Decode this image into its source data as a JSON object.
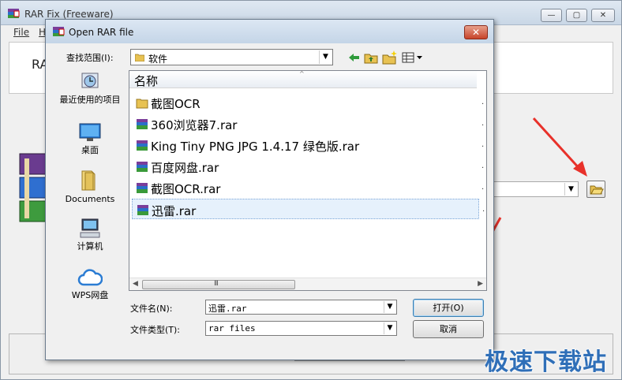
{
  "app": {
    "title": "RAR Fix (Freeware)",
    "menu": {
      "file": "File",
      "help": "H"
    },
    "header_text": "RA",
    "window_buttons": {
      "minimize": "—",
      "maximize": "▢",
      "close": "✕"
    }
  },
  "dialog": {
    "title": "Open RAR file",
    "close_label": "✕",
    "look_in_label": "查找范围(I):",
    "look_in_value": "软件",
    "places": [
      {
        "label": "最近使用的项目",
        "icon": "recent-places-icon"
      },
      {
        "label": "桌面",
        "icon": "desktop-icon"
      },
      {
        "label": "Documents",
        "icon": "documents-folder-icon"
      },
      {
        "label": "计算机",
        "icon": "computer-icon"
      },
      {
        "label": "WPS网盘",
        "icon": "wps-cloud-icon"
      }
    ],
    "list": {
      "column_header": "名称",
      "sort_glyph": "^",
      "row_clip_glyph": ".",
      "items": [
        {
          "name": "截图OCR",
          "type": "folder"
        },
        {
          "name": "360浏览器7.rar",
          "type": "rar"
        },
        {
          "name": "King Tiny PNG JPG 1.4.17 绿色版.rar",
          "type": "rar"
        },
        {
          "name": "百度网盘.rar",
          "type": "rar"
        },
        {
          "name": "截图OCR.rar",
          "type": "rar"
        },
        {
          "name": "迅雷.rar",
          "type": "rar",
          "selected": true
        }
      ],
      "hscroll_grip": "III"
    },
    "file_name_label": "文件名(N):",
    "file_name_value": "迅雷.rar",
    "file_type_label": "文件类型(T):",
    "file_type_value": "rar files",
    "open_button": "打开(O)",
    "cancel_button": "取消"
  },
  "watermark": "极速下载站",
  "colors": {
    "accent_blue": "#2f6fb8",
    "arrow_red": "#e8312a",
    "selection": "#e6f1fc"
  }
}
